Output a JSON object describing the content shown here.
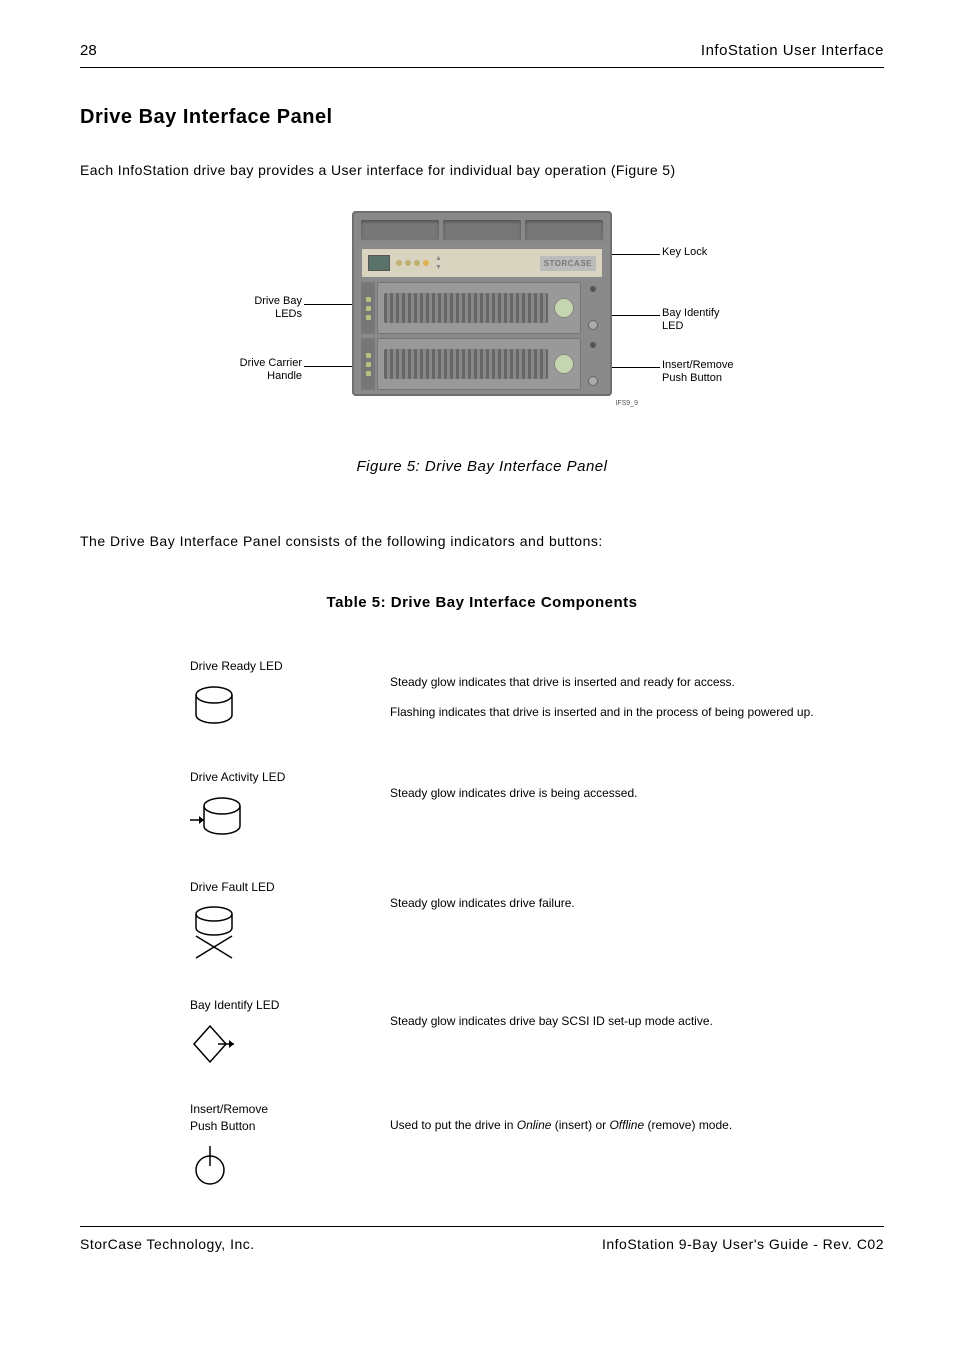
{
  "header": {
    "page_number": "28",
    "title": "InfoStation User Interface"
  },
  "section_title": "Drive Bay Interface Panel",
  "intro_text": "Each InfoStation drive bay provides a User interface for individual bay operation (Figure 5)",
  "figure": {
    "logo_text": "STORCASE",
    "ifs_label": "IFS9_9",
    "caption": "Figure 5:  Drive Bay Interface Panel",
    "callouts": {
      "drive_bay_leds": "Drive Bay\nLEDs",
      "drive_carrier_handle": "Drive Carrier\nHandle",
      "key_lock": "Key Lock",
      "bay_identify_led": "Bay Identify\nLED",
      "insert_remove_push_button": "Insert/Remove\nPush Button"
    }
  },
  "consists_text": "The Drive Bay Interface Panel consists of the following indicators and buttons:",
  "table_title": "Table 5:  Drive Bay Interface Components",
  "components": [
    {
      "name": "Drive Ready LED",
      "icon": "drive-ready-icon",
      "desc": [
        "Steady glow indicates that drive is inserted and ready for access.",
        "Flashing indicates that drive is inserted and in the process of being powered up."
      ]
    },
    {
      "name": "Drive Activity LED",
      "icon": "drive-activity-icon",
      "desc": [
        "Steady glow indicates drive is being accessed."
      ]
    },
    {
      "name": "Drive Fault LED",
      "icon": "drive-fault-icon",
      "desc": [
        "Steady glow indicates drive failure."
      ]
    },
    {
      "name": "Bay Identify LED",
      "icon": "bay-identify-icon",
      "desc": [
        "Steady glow indicates drive bay SCSI ID set-up mode active."
      ]
    },
    {
      "name": "Insert/Remove Push Button",
      "icon": "push-button-icon",
      "desc_html": "Used to put the drive in <em>Online</em> (insert) or <em>Offline</em> (remove) mode."
    }
  ],
  "footer": {
    "left": "StorCase Technology, Inc.",
    "right": "InfoStation 9-Bay User's Guide - Rev. C02"
  }
}
